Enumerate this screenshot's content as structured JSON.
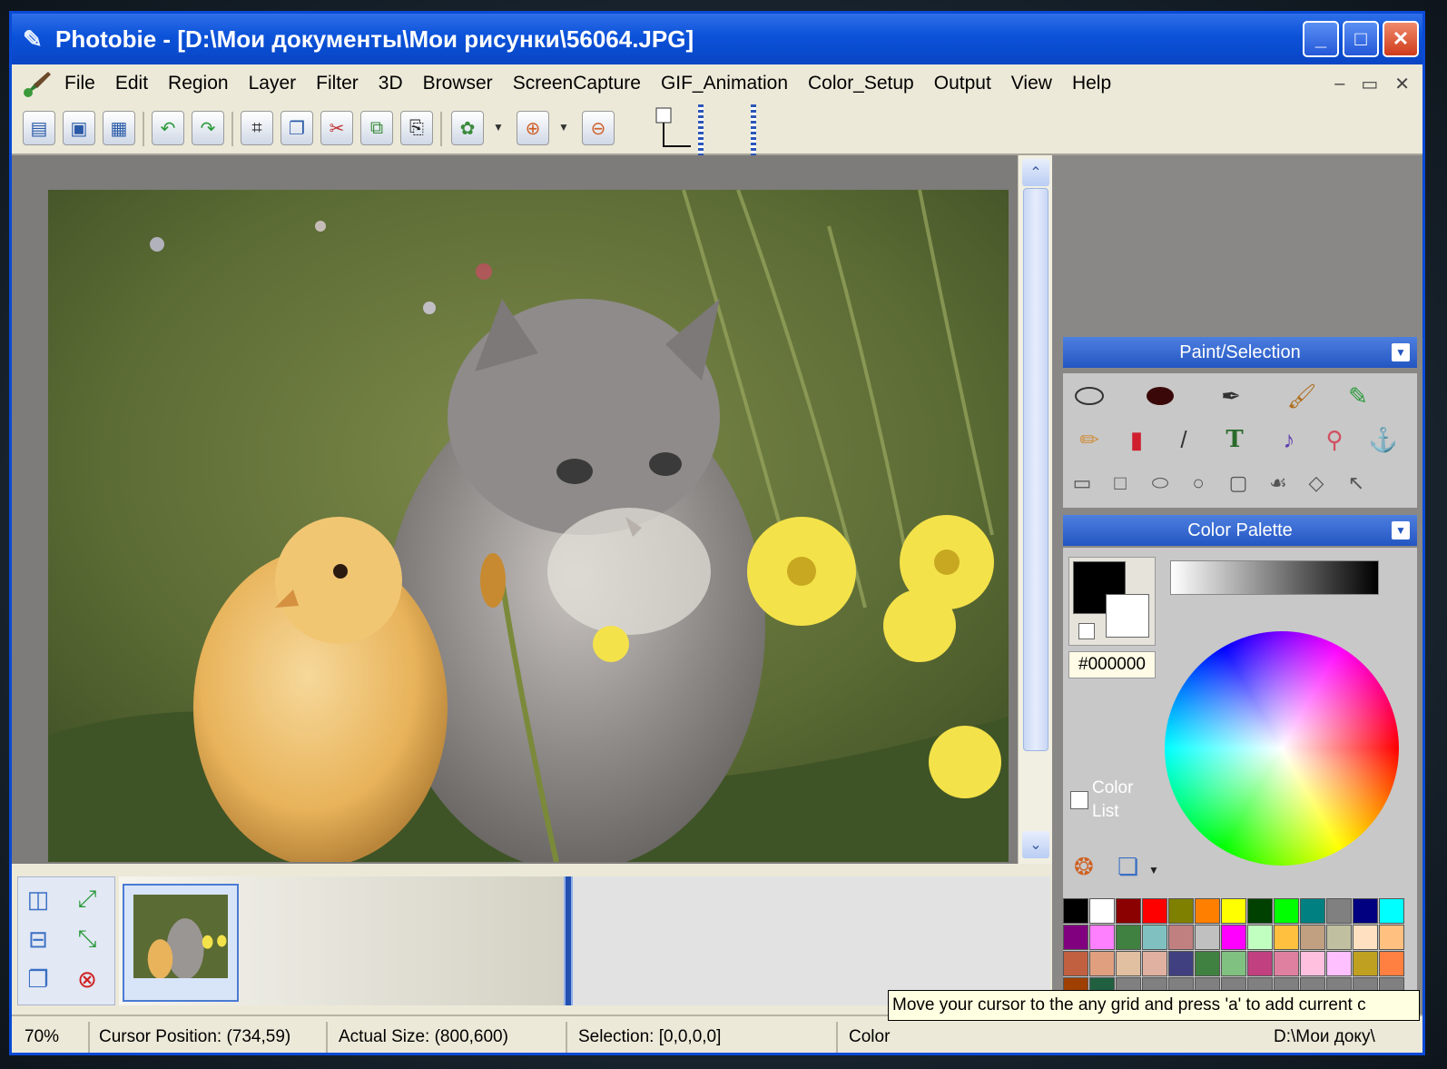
{
  "window": {
    "title": "Photobie - [D:\\Мои документы\\Мои рисунки\\56064.JPG]",
    "minimize_label": "_",
    "maximize_label": "□",
    "close_label": "✕"
  },
  "menu": {
    "items": [
      "File",
      "Edit",
      "Region",
      "Layer",
      "Filter",
      "3D",
      "Browser",
      "ScreenCapture",
      "GIF_Animation",
      "Color_Setup",
      "Output",
      "View",
      "Help"
    ],
    "mdi_minimize": "–",
    "mdi_restore": "▭",
    "mdi_close": "✕"
  },
  "toolbar": {
    "icons": [
      "new-icon",
      "open-icon",
      "save-icon",
      "undo-icon",
      "redo-icon",
      "crop-icon",
      "copy-icon",
      "cut-icon",
      "paste-into-icon",
      "paste-icon",
      "effects-icon",
      "zoom-in-icon",
      "zoom-out-icon"
    ]
  },
  "panels": {
    "paint_title": "Paint/Selection",
    "palette_title": "Color Palette",
    "current_color": "#000000",
    "color_list_label_1": "Color",
    "color_list_label_2": "List",
    "text_tool_glyph": "T"
  },
  "palette_colors": [
    "#000000",
    "#ffffff",
    "#8b0000",
    "#ff0000",
    "#808000",
    "#ff8000",
    "#ffff00",
    "#004000",
    "#00ff00",
    "#008080",
    "#808080",
    "#000080",
    "#00ffff",
    "#800080",
    "#ff80ff",
    "#408040",
    "#80c0c0",
    "#c08080",
    "#c0c0c0",
    "#ff00ff",
    "#c0ffc0",
    "#ffc040",
    "#c0a080",
    "#c0c0a0",
    "#ffe0c0",
    "#ffc080",
    "#c06040",
    "#e0a080",
    "#e0c0a0",
    "#e0b0a0",
    "#404080",
    "#408040",
    "#80c080",
    "#c04080",
    "#e080a0",
    "#ffc0e0",
    "#ffc0ff",
    "#c0a020",
    "#ff8040",
    "#a04000",
    "#206040",
    "#808080",
    "#808080",
    "#808080",
    "#808080",
    "#808080",
    "#808080",
    "#808080",
    "#808080",
    "#808080",
    "#808080",
    "#808080",
    "#808080",
    "#808080",
    "#808080",
    "#808080",
    "#808080",
    "#808080",
    "#808080",
    "#808080",
    "#808080",
    "#808080",
    "#808080",
    "#808080",
    "#808080"
  ],
  "status": {
    "zoom": "70%",
    "cursor": "Cursor Position: (734,59)",
    "actual_size": "Actual Size: (800,600)",
    "selection": "Selection: [0,0,0,0]",
    "color": "Color",
    "path": "D:\\Мои доку\\"
  },
  "tooltip": "Move your cursor to the any grid and press 'a' to add current c"
}
